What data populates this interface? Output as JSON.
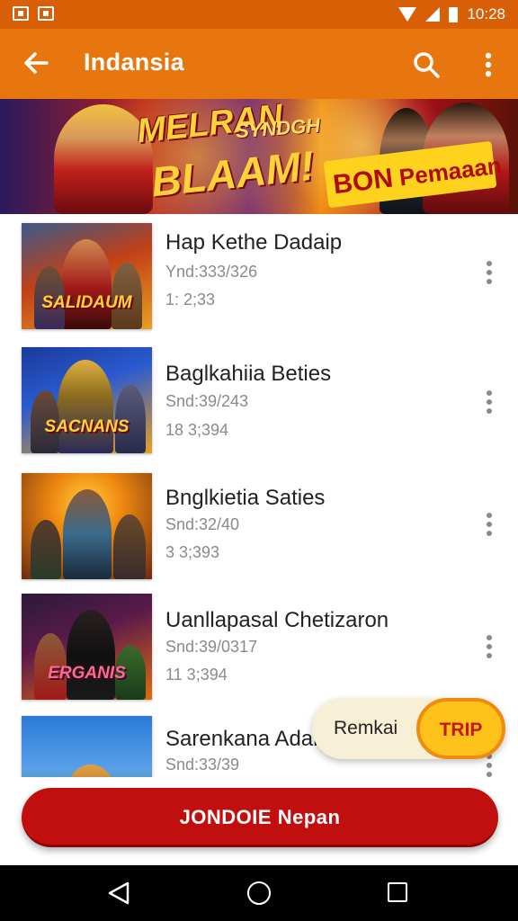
{
  "status_bar": {
    "time": "10:28",
    "icons": [
      "notification-icon",
      "image-icon",
      "wifi-icon",
      "signal-icon",
      "battery-icon"
    ]
  },
  "app_bar": {
    "title": "Indansia",
    "icons": [
      "back-arrow-icon",
      "search-icon",
      "more-vert-icon"
    ]
  },
  "banner": {
    "headline_top": "MELRAN",
    "headline_small": "SYNDGH",
    "headline_main": "BLAAM!",
    "badge_text_lead": "BON",
    "badge_text": "Pemaaan"
  },
  "list": {
    "items": [
      {
        "title": "Hap Kethe Dadaip",
        "sub1": "Ynd:333/326",
        "sub2": "1: 2;33",
        "thumb_label": "SALIDAUM"
      },
      {
        "title": "Baglkahiia Beties",
        "sub1": "Snd:39/243",
        "sub2": "18 3;394",
        "thumb_label": "SACNANS"
      },
      {
        "title": "Bnglkietia Saties",
        "sub1": "Snd:32/40",
        "sub2": "3 3;393",
        "thumb_label": ""
      },
      {
        "title": "Uanllapasal Chetizaron",
        "sub1": "Snd:39/0317",
        "sub2": "11 3;394",
        "thumb_label": "ERGANIS"
      },
      {
        "title": "Sarenkana Adan",
        "sub1": "Snd:33/39",
        "sub2": "",
        "thumb_label": ""
      }
    ]
  },
  "snackbar": {
    "text": "Remkai",
    "action_label": "TRIP"
  },
  "cta": {
    "label": "JONDOIE Nepan"
  },
  "nav": {
    "icons": [
      "nav-back-icon",
      "nav-home-icon",
      "nav-recents-icon"
    ]
  },
  "colors": {
    "status_bar": "#d95f06",
    "app_bar": "#e8760e",
    "cta": "#c10e0e",
    "snack_button": "#ffc21a"
  }
}
